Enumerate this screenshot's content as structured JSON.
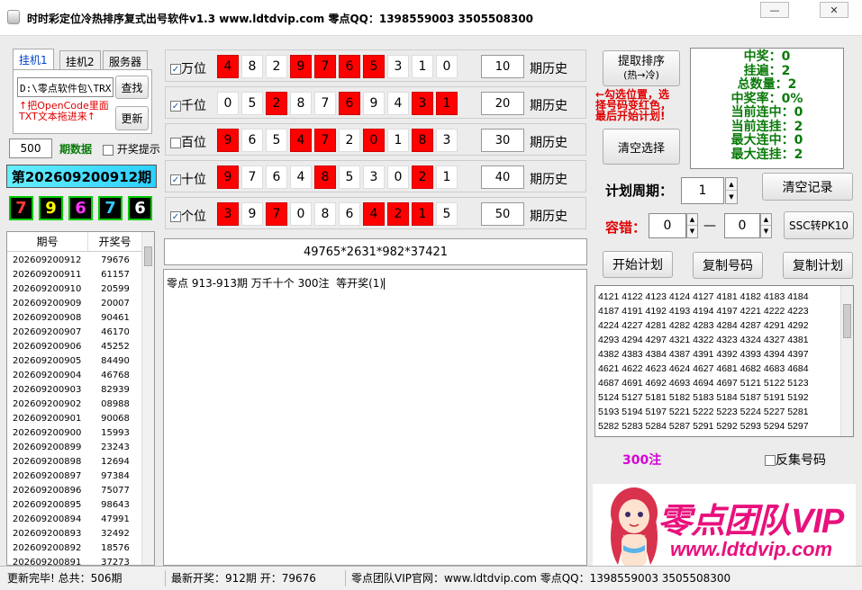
{
  "window": {
    "title": "时时彩定位冷热排序复式出号软件v1.3    www.ldtdvip.com     零点QQ：1398559003  3505508300",
    "min_symbol": "—",
    "close_symbol": "✕"
  },
  "tabs": [
    "挂机1",
    "挂机2",
    "服务器"
  ],
  "left": {
    "path_value": "D:\\零点软件包\\TRX",
    "find_btn": "查找",
    "refresh_btn": "更新",
    "tip_line1": "↑把OpenCode里面",
    "tip_line2": "TXT文本拖进来↑",
    "count_value": "500",
    "period_label": "期数据",
    "notify_label": "开奖提示",
    "issue_title": "第202609200912期",
    "balls": [
      {
        "d": "7",
        "color": "#ff3a3a"
      },
      {
        "d": "9",
        "color": "#ffff00"
      },
      {
        "d": "6",
        "color": "#ff33ff"
      },
      {
        "d": "7",
        "color": "#33ccff"
      },
      {
        "d": "6",
        "color": "#ffffff"
      }
    ],
    "list_header": {
      "issue": "期号",
      "result": "开奖号"
    },
    "history": [
      [
        "202609200912",
        "79676"
      ],
      [
        "202609200911",
        "61157"
      ],
      [
        "202609200910",
        "20599"
      ],
      [
        "202609200909",
        "20007"
      ],
      [
        "202609200908",
        "90461"
      ],
      [
        "202609200907",
        "46170"
      ],
      [
        "202609200906",
        "45252"
      ],
      [
        "202609200905",
        "84490"
      ],
      [
        "202609200904",
        "46768"
      ],
      [
        "202609200903",
        "82939"
      ],
      [
        "202609200902",
        "08988"
      ],
      [
        "202609200901",
        "90068"
      ],
      [
        "202609200900",
        "15993"
      ],
      [
        "202609200899",
        "23243"
      ],
      [
        "202609200898",
        "12694"
      ],
      [
        "202609200897",
        "97384"
      ],
      [
        "202609200896",
        "75077"
      ],
      [
        "202609200895",
        "98643"
      ],
      [
        "202609200894",
        "47991"
      ],
      [
        "202609200893",
        "32492"
      ],
      [
        "202609200892",
        "18576"
      ],
      [
        "202609200891",
        "37273"
      ]
    ]
  },
  "positions": [
    {
      "label": "万位",
      "checked": true,
      "digits": [
        "4",
        "8",
        "2",
        "9",
        "7",
        "6",
        "5",
        "3",
        "1",
        "0"
      ],
      "red": [
        0,
        3,
        4,
        5,
        6
      ],
      "count": "10",
      "suffix": "期历史"
    },
    {
      "label": "千位",
      "checked": true,
      "digits": [
        "0",
        "5",
        "2",
        "8",
        "7",
        "6",
        "9",
        "4",
        "3",
        "1"
      ],
      "red": [
        2,
        5,
        8,
        9
      ],
      "count": "20",
      "suffix": "期历史"
    },
    {
      "label": "百位",
      "checked": false,
      "digits": [
        "9",
        "6",
        "5",
        "4",
        "7",
        "2",
        "0",
        "1",
        "8",
        "3"
      ],
      "red": [
        0,
        3,
        4,
        6,
        8
      ],
      "count": "30",
      "suffix": "期历史"
    },
    {
      "label": "十位",
      "checked": true,
      "digits": [
        "9",
        "7",
        "6",
        "4",
        "8",
        "5",
        "3",
        "0",
        "2",
        "1"
      ],
      "red": [
        0,
        4,
        8
      ],
      "count": "40",
      "suffix": "期历史"
    },
    {
      "label": "个位",
      "checked": true,
      "digits": [
        "3",
        "9",
        "7",
        "0",
        "8",
        "6",
        "4",
        "2",
        "1",
        "5"
      ],
      "red": [
        0,
        2,
        6,
        7,
        8
      ],
      "count": "50",
      "suffix": "期历史"
    }
  ],
  "formula": "49765*2631*982*37421",
  "output_text": "零点 913-913期 万千十个 300注  等开奖(1)",
  "right": {
    "extract_btn_line1": "提取排序",
    "extract_btn_line2": "(热→冷)",
    "tip_line1": "←勾选位置，选",
    "tip_line2": "择号码变红色，",
    "tip_line3": "最后开始计划!",
    "clear_select_btn": "清空选择",
    "stats": [
      "中奖：0",
      "挂遍：2",
      "总数量：2",
      "中奖率：0%",
      "当前连中：0",
      "当前连挂：2",
      "最大连中：0",
      "最大连挂：2"
    ],
    "plan_period_label": "计划周期：",
    "plan_period_value": "1",
    "clear_record_btn": "清空记录",
    "tolerance_label": "容错：",
    "tol_min": "0",
    "tol_dash": "—",
    "tol_max": "0",
    "ssc_pk10_btn": "SSC转PK10",
    "start_plan_btn": "开始计划",
    "copy_num_btn": "复制号码",
    "copy_plan_btn": "复制计划",
    "numbers": [
      "4121 4122 4123 4124 4127 4181 4182 4183 4184",
      "4187 4191 4192 4193 4194 4197 4221 4222 4223",
      "4224 4227 4281 4282 4283 4284 4287 4291 4292",
      "4293 4294 4297 4321 4322 4323 4324 4327 4381",
      "4382 4383 4384 4387 4391 4392 4393 4394 4397",
      "4621 4622 4623 4624 4627 4681 4682 4683 4684",
      "4687 4691 4692 4693 4694 4697 5121 5122 5123",
      "5124 5127 5181 5182 5183 5184 5187 5191 5192",
      "5193 5194 5197 5221 5222 5223 5224 5227 5281",
      "5282 5283 5284 5287 5291 5292 5293 5294 5297"
    ],
    "bet_count": "300注",
    "reverse_label": "反集号码",
    "ad_title": "零点团队VIP",
    "ad_url": "www.ldtdvip.com"
  },
  "status": {
    "s1": "更新完毕! 总共：506期",
    "s2": "最新开奖：912期 开：79676",
    "s3": "零点团队VIP官网：www.ldtdvip.com   零点QQ：1398559003  3505508300"
  }
}
